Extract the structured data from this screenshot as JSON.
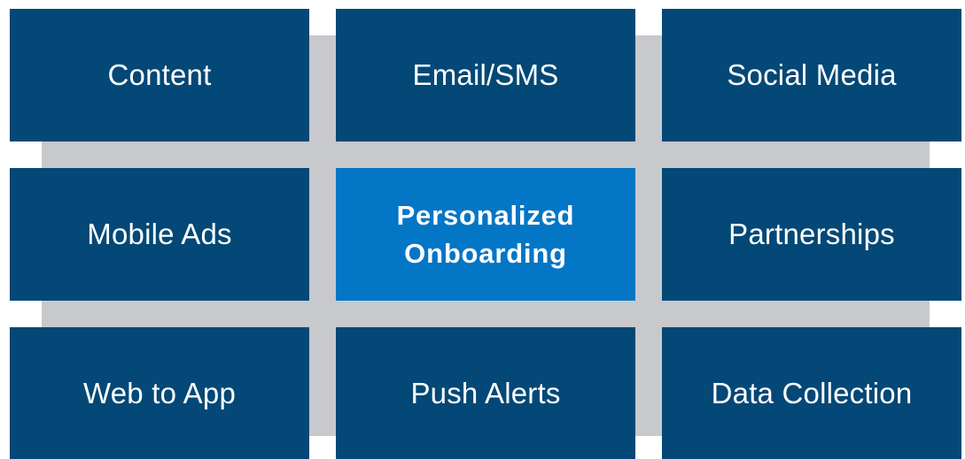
{
  "colors": {
    "tile": "#034876",
    "center_tile": "#0376c6",
    "backdrop": "#c7c9cc",
    "text": "#ffffff"
  },
  "tiles": {
    "top_left": "Content",
    "top_center": "Email/SMS",
    "top_right": "Social Media",
    "middle_left": "Mobile Ads",
    "center": "Personalized\nOnboarding",
    "middle_right": "Partnerships",
    "bottom_left": "Web to App",
    "bottom_center": "Push Alerts",
    "bottom_right": "Data Collection"
  }
}
